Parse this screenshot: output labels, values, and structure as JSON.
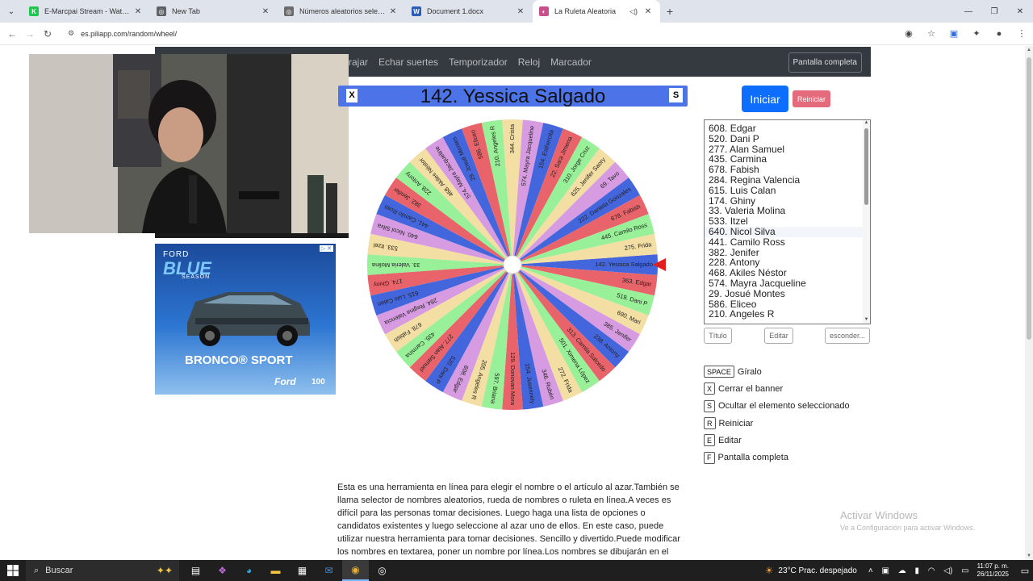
{
  "browser": {
    "tabs": [
      {
        "label": "E-Marcpai Stream - Watch Live",
        "favicon": "kick-icon",
        "fav_color": "#1ec74d",
        "fav_letter": "K"
      },
      {
        "label": "New Tab",
        "favicon": "newtab-icon",
        "fav_color": "#5f6368",
        "fav_letter": "◎"
      },
      {
        "label": "Números aleatorios seleccionar",
        "favicon": "piliapp-icon",
        "fav_color": "#6b6b6b",
        "fav_letter": "◎"
      },
      {
        "label": "Document 1.docx",
        "favicon": "word-icon",
        "fav_color": "#2b5cb8",
        "fav_letter": "W"
      },
      {
        "label": "La Ruleta Aleatoria",
        "favicon": "piliapp-icon",
        "fav_color": "#c94f8a",
        "fav_letter": "◐"
      }
    ],
    "url": "es.piliapp.com/random/wheel/"
  },
  "site_nav": {
    "links": [
      "rajar",
      "Echar suertes",
      "Temporizador",
      "Reloj",
      "Marcador"
    ],
    "fullscreen_label": "Pantalla completa"
  },
  "ad": {
    "brand_top": "FORD",
    "headline": "BLUE",
    "sub": "SEASON",
    "product": "BRONCO® SPORT",
    "logo": "Ford",
    "anniversary": "100"
  },
  "selected": {
    "x_key": "X",
    "s_key": "S",
    "text": "142. Yessica Salgado"
  },
  "controls": {
    "start_label": "Iniciar",
    "reset_label": "Reiniciar",
    "title_button": "Título",
    "edit_button": "Editar",
    "hide_button": "esconder..."
  },
  "names_list": [
    "608. Edgar",
    "520. Dani P",
    "277. Alan Samuel",
    "435. Carmina",
    "678. Fabish",
    "284. Regina Valencia",
    "615. Luis Calan",
    "174. Ghiny",
    "33. Valeria Molina",
    "533. Itzel",
    "640. Nicol Silva",
    "441. Camilo Ross",
    "382. Jenifer",
    "228. Antony",
    "468. Akiles Néstor",
    "574. Mayra Jacqueline",
    "29. Josué Montes",
    "586. Eliceo",
    "210. Angeles R"
  ],
  "wheel": {
    "labels": [
      "142. Yessica Salgado",
      "363. Edgar",
      "519. Dani P",
      "690. Mari",
      "385. Jenifer",
      "238. Antony",
      "313. Camila Salcedo",
      "501. Ximena López",
      "272. Frida",
      "346. Rubén",
      "154. Jusennely",
      "129. Donovan Mora",
      "597. Briana",
      "205. Angeles R",
      "608. Edgar",
      "520. Dani P",
      "277. Alan Samuel",
      "435. Carmina",
      "678. Fabish",
      "284. Regina Valencia",
      "615. Luis Calan",
      "174. Ghiny",
      "33. Valeria Molina",
      "533. Itzel",
      "640. Nicol Silva",
      "441. Camilo Ross",
      "382. Jenifer",
      "228. Antony",
      "468. Akiles Néstor",
      "574. Mayra Jacqueline",
      "29. Josué Montes",
      "586. Eliceo",
      "210. Angeles R",
      "344. Crista",
      "574. Mayra Jacqueline",
      "154. Esthercita",
      "22. Sara Jimena",
      "310. Jorge Cruz",
      "625. Jenifer Saory",
      "69. Tavo",
      "222. Daniela Gonzales",
      "678. Fabish",
      "445. Camilo Ross",
      "275. Frida"
    ],
    "colors": [
      "#4466dd",
      "#e8646a",
      "#98f098",
      "#f3dea4",
      "#d69be0"
    ],
    "pointer_color": "#e21f1f"
  },
  "shortcuts": [
    {
      "key": "SPACE",
      "label": "Gíralo"
    },
    {
      "key": "X",
      "label": "Cerrar el banner"
    },
    {
      "key": "S",
      "label": "Ocultar el elemento seleccionado"
    },
    {
      "key": "R",
      "label": "Reiniciar"
    },
    {
      "key": "E",
      "label": "Editar"
    },
    {
      "key": "F",
      "label": "Pantalla completa"
    }
  ],
  "description": "Esta es una herramienta en línea para elegir el nombre o el artículo al azar.También se llama selector de nombres aleatorios, rueda de nombres o ruleta en línea.A veces es difícil para las personas tomar decisiones. Luego haga una lista de opciones o candidatos existentes y luego seleccione al azar uno de ellos. En este caso, puede utilizar nuestra herramienta para tomar decisiones. Sencillo y divertido.Puede modificar los nombres en textarea, poner un nombre por línea.Los nombres se dibujarán en el círculo.Simplemente haga clic en la rueda",
  "watermark": {
    "line1": "Activar Windows",
    "line2": "Ve a Configuración para activar Windows."
  },
  "taskbar": {
    "search_label": "Buscar",
    "weather": "23°C  Prac. despejado",
    "time": "11:07 p. m.",
    "date": "26/11/2025"
  }
}
